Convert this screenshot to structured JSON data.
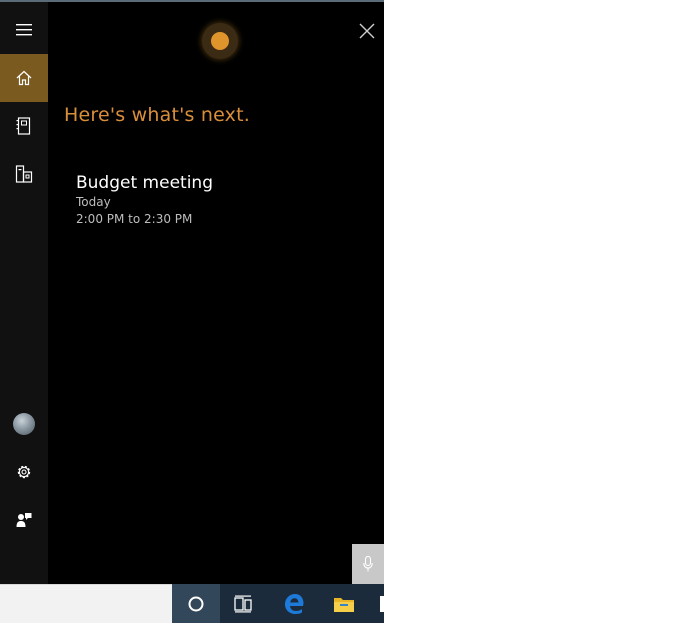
{
  "cortana": {
    "heading": "Here's what's next.",
    "event": {
      "title": "Budget meeting",
      "day": "Today",
      "time": "2:00 PM to 2:30 PM"
    }
  },
  "sidebar": {
    "items": [
      {
        "icon": "hamburger-menu-icon"
      },
      {
        "icon": "home-icon",
        "selected": true
      },
      {
        "icon": "notebook-icon"
      },
      {
        "icon": "devices-icon"
      },
      {
        "icon": "user-avatar"
      },
      {
        "icon": "gear-icon"
      },
      {
        "icon": "feedback-icon"
      }
    ]
  },
  "taskbar": {
    "items": [
      {
        "icon": "cortana-circle-icon",
        "active": true
      },
      {
        "icon": "task-view-icon"
      },
      {
        "icon": "edge-browser-icon"
      },
      {
        "icon": "file-explorer-icon"
      }
    ]
  },
  "colors": {
    "accent": "#d98f3a",
    "cortana_dot": "#e0952c",
    "sidebar_selected": "#7b5a1f",
    "panel_bg": "#000000",
    "taskbar_bg": "#1c2b3b"
  }
}
